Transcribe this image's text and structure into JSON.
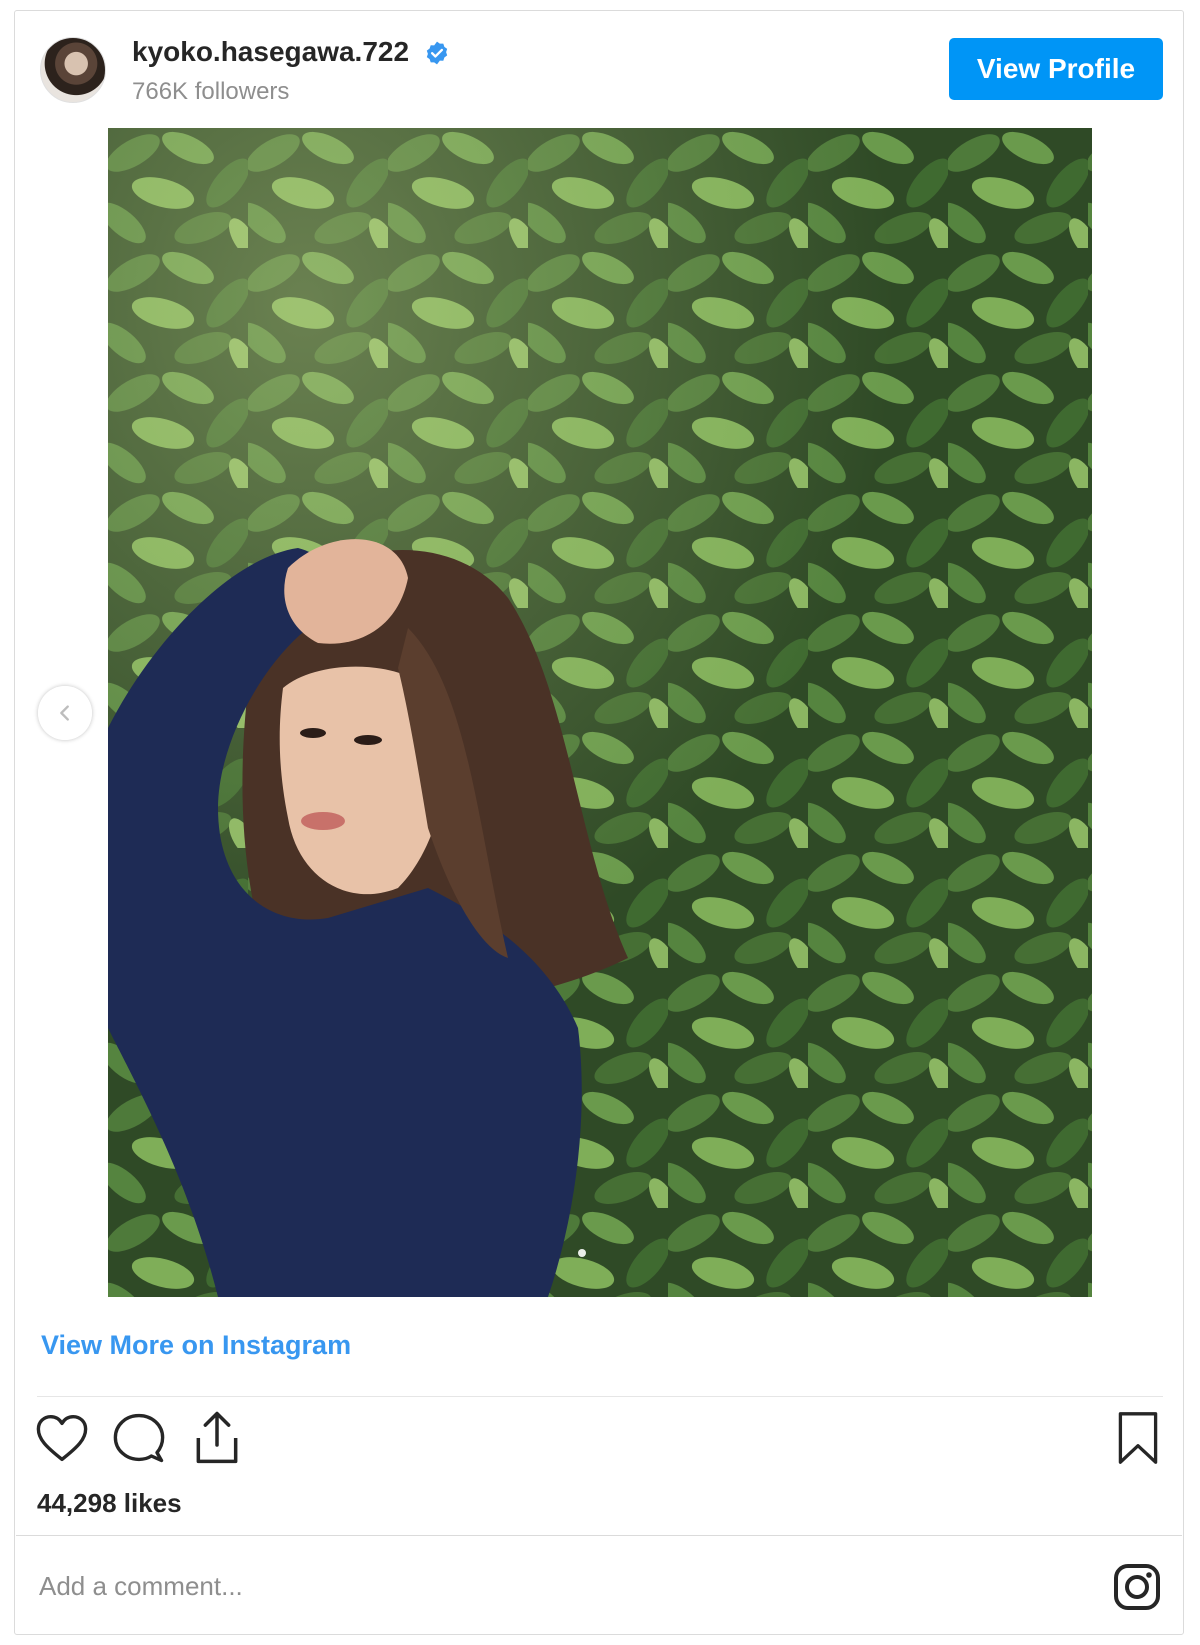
{
  "header": {
    "username": "kyoko.hasegawa.722",
    "followers": "766K followers",
    "view_profile_label": "View Profile",
    "verified_icon": "verified-badge-icon",
    "accent_color": "#0095f6"
  },
  "post": {
    "view_more_label": "View More on Instagram",
    "likes": "44,298 likes",
    "carousel_nav_icon": "chevron-left-icon",
    "image_description_icon": "photo"
  },
  "actions": {
    "like_icon": "heart-icon",
    "comment_icon": "comment-icon",
    "share_icon": "share-icon",
    "save_icon": "bookmark-icon"
  },
  "comment": {
    "placeholder": "Add a comment...",
    "instagram_icon": "instagram-icon"
  }
}
